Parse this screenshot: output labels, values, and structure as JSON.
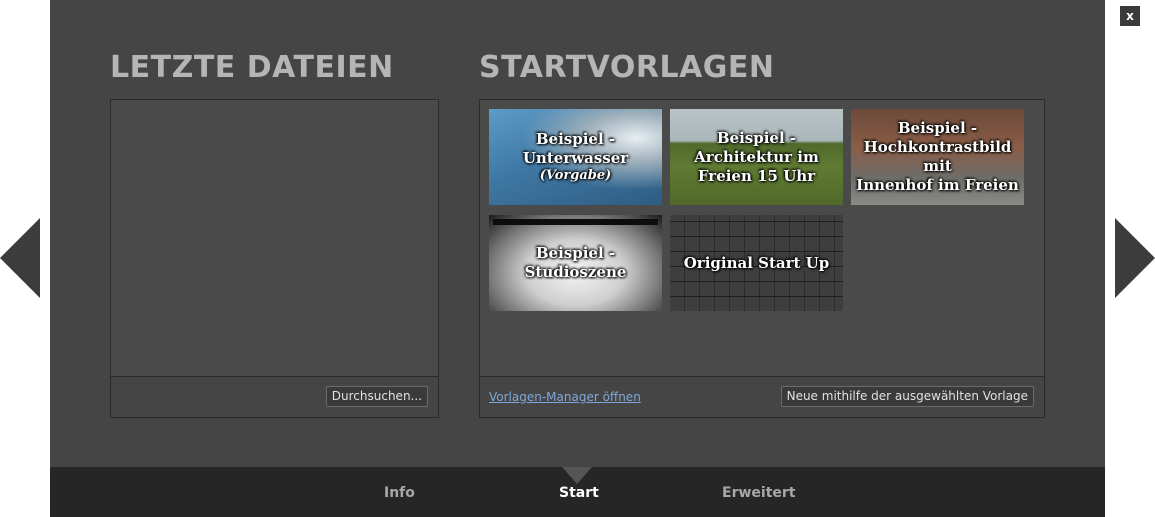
{
  "dialog": {
    "close_label": "x"
  },
  "recent": {
    "title": "LETZTE DATEIEN",
    "browse_label": "Durchsuchen..."
  },
  "templates": {
    "title": "STARTVORLAGEN",
    "manager_link": "Vorlagen-Manager öffnen",
    "new_button": "Neue mithilfe der ausgewählten Vorlage",
    "items": [
      {
        "line1": "Beispiel -",
        "line2": "Unterwasser",
        "sub": "(Vorgabe)"
      },
      {
        "line1": "Beispiel -",
        "line2": "Architektur im",
        "line3": "Freien 15 Uhr"
      },
      {
        "line1": "Beispiel -",
        "line2": "Hochkontrastbild mit",
        "line3": "Innenhof im Freien"
      },
      {
        "line1": "Beispiel -",
        "line2": "Studioszene"
      },
      {
        "line1": "Original Start Up"
      }
    ]
  },
  "tabs": [
    {
      "label": "Info"
    },
    {
      "label": "Start"
    },
    {
      "label": "Erweitert"
    }
  ],
  "icons": {
    "prev": "chevron-left-icon",
    "next": "chevron-right-icon"
  },
  "colors": {
    "background": "#454545",
    "tabbar": "#262626",
    "link": "#7ea6d8"
  }
}
